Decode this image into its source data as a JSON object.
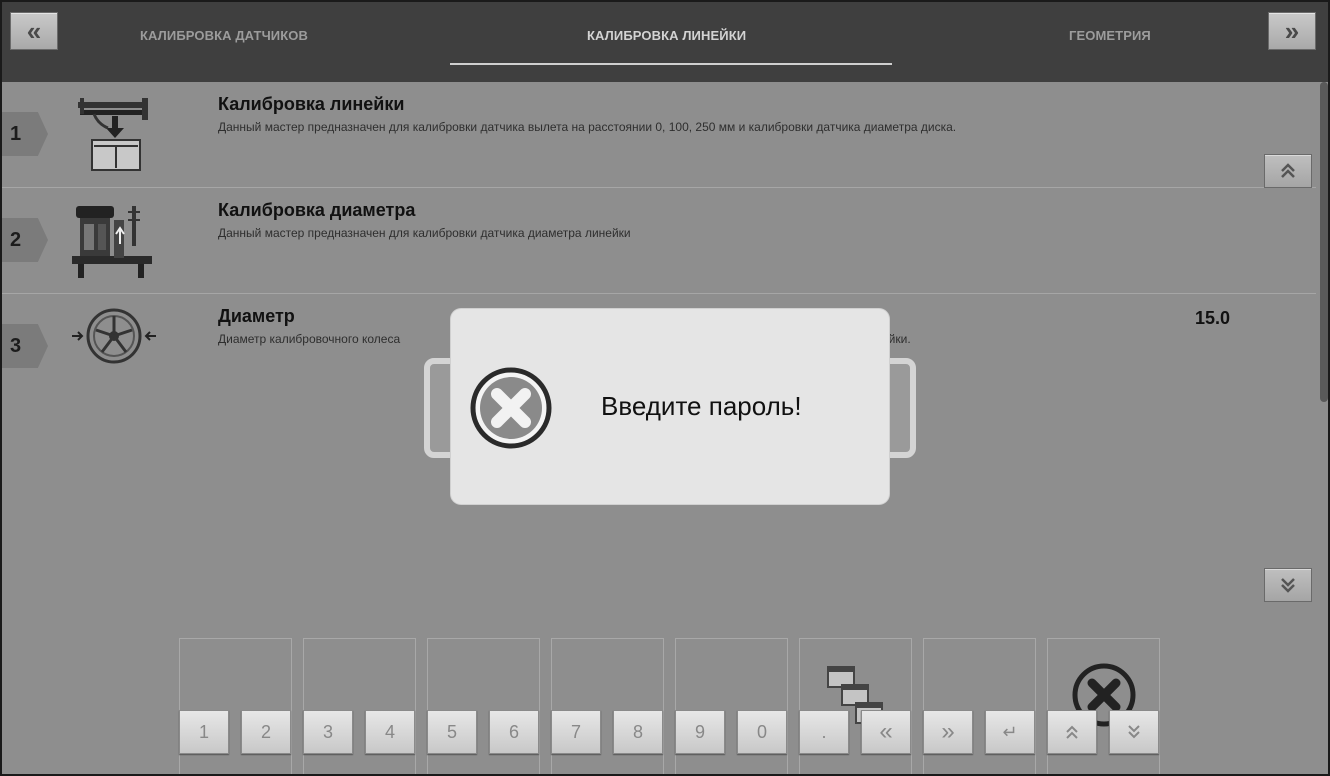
{
  "header": {
    "prev_label": "«",
    "next_label": "»",
    "tabs": [
      {
        "label": "КАЛИБРОВКА ДАТЧИКОВ"
      },
      {
        "label": "КАЛИБРОВКА ЛИНЕЙКИ"
      },
      {
        "label": "ГЕОМЕТРИЯ"
      }
    ]
  },
  "items": [
    {
      "num": "1",
      "title": "Калибровка линейки",
      "desc": "Данный мастер предназначен для калибровки датчика вылета на расстоянии 0, 100, 250 мм и калибровки датчика диаметра диска.",
      "icon": "ruler-calibration-icon"
    },
    {
      "num": "2",
      "title": "Калибровка диаметра",
      "desc": "Данный мастер предназначен для калибровки датчика диаметра линейки",
      "icon": "diameter-calibration-icon"
    },
    {
      "num": "3",
      "title": "Диаметр",
      "desc": "Диаметр калибровочного колеса",
      "desc_tail": "ейки.",
      "value": "15.0",
      "icon": "wheel-diameter-icon"
    }
  ],
  "side": {
    "up_label": "≈",
    "down_label": "≈"
  },
  "keypad": {
    "keys": [
      "1",
      "2",
      "3",
      "4",
      "5",
      "6",
      "7",
      "8",
      "9",
      "0",
      ".",
      "«",
      "»",
      "↵",
      "⌃",
      "⌄"
    ]
  },
  "modal": {
    "message": "Введите пароль!",
    "icon": "error-x-icon"
  }
}
